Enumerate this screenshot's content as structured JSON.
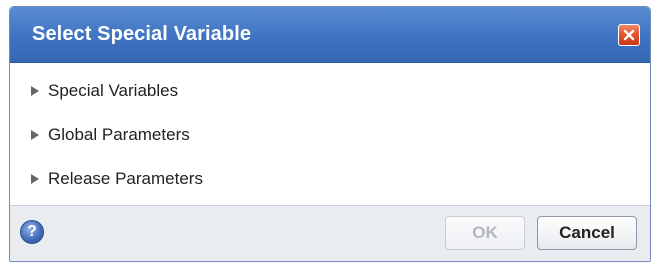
{
  "dialog": {
    "title": "Select Special Variable",
    "close_icon": "close-icon"
  },
  "tree": {
    "items": [
      {
        "label": "Special Variables",
        "expanded": false
      },
      {
        "label": "Global Parameters",
        "expanded": false
      },
      {
        "label": "Release Parameters",
        "expanded": false
      }
    ]
  },
  "footer": {
    "help_icon": "question-mark-icon",
    "help_symbol": "?",
    "ok_label": "OK",
    "ok_enabled": false,
    "cancel_label": "Cancel"
  },
  "colors": {
    "titlebar": "#3f74c2",
    "close_button": "#e2522e",
    "footer": "#e9edf2",
    "arrow": "#666666"
  }
}
